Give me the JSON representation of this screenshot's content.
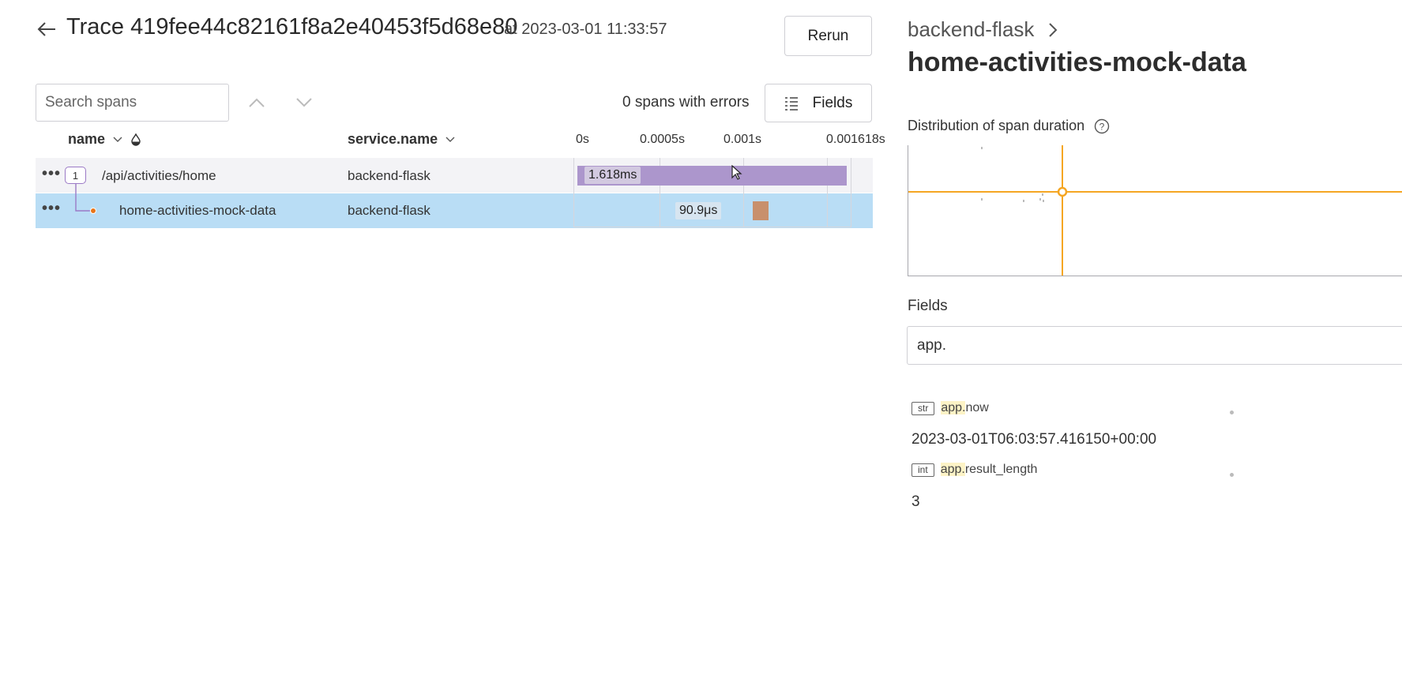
{
  "header": {
    "trace_title": "Trace 419fee44c82161f8a2e40453f5d68e80",
    "timestamp": "at 2023-03-01 11:33:57",
    "rerun_label": "Rerun"
  },
  "toolbar": {
    "search_placeholder": "Search spans",
    "errors_text": "0 spans with errors",
    "fields_label": "Fields"
  },
  "table": {
    "columns": {
      "name": "name",
      "service": "service.name"
    },
    "ticks": [
      "0s",
      "0.0005s",
      "0.001s",
      "0.001618s"
    ],
    "rows": [
      {
        "count": "1",
        "name": "/api/activities/home",
        "service": "backend-flask",
        "duration": "1.618ms"
      },
      {
        "name": "home-activities-mock-data",
        "service": "backend-flask",
        "duration": "90.9μs"
      }
    ]
  },
  "details": {
    "service": "backend-flask",
    "span_name": "home-activities-mock-data",
    "distribution_label": "Distribution of span duration",
    "fields_heading": "Fields",
    "field_filter_value": "app.",
    "fields": [
      {
        "type": "str",
        "prefix": "app.",
        "key": "now",
        "value": "2023-03-01T06:03:57.416150+00:00"
      },
      {
        "type": "int",
        "prefix": "app.",
        "key": "result_length",
        "value": "3"
      }
    ]
  },
  "colors": {
    "parent_span": "#ac96cc",
    "child_span": "#c8906c",
    "selected_row": "#b9ddf5",
    "crosshair": "#f5a623"
  },
  "icons": [
    "back-arrow-icon",
    "chevron-up-icon",
    "chevron-down-icon",
    "fields-list-icon",
    "sort-chevron-icon",
    "heatmap-drop-icon",
    "breadcrumb-chevron-icon",
    "help-icon",
    "more-dots-icon"
  ]
}
